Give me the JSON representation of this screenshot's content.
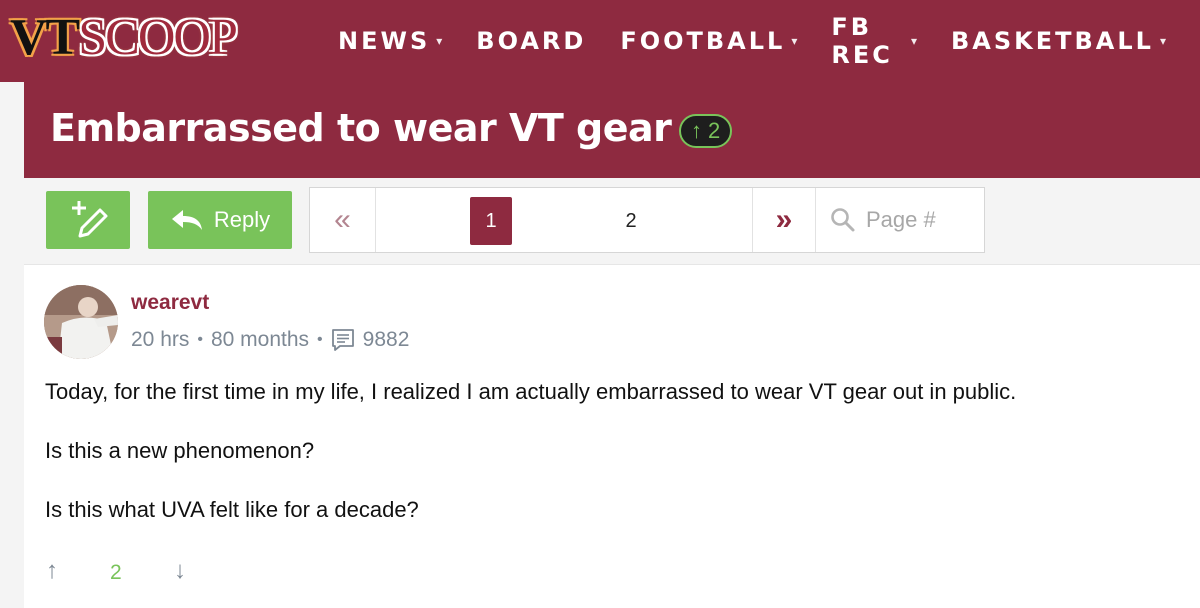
{
  "site": {
    "logo_a": "VT",
    "logo_b": "SCOOP"
  },
  "nav": [
    {
      "label": "NEWS",
      "caret": "▾"
    },
    {
      "label": "BOARD",
      "caret": ""
    },
    {
      "label": "FOOTBALL",
      "caret": "▾"
    },
    {
      "label": "FB REC",
      "caret": "▾"
    },
    {
      "label": "BASKETBALL",
      "caret": "▾"
    }
  ],
  "thread": {
    "title": "Embarrassed to wear VT gear",
    "vote_arrow": "↑",
    "vote_count": "2"
  },
  "toolbar": {
    "reply_label": "Reply",
    "page_placeholder": "Page #",
    "prev": "«",
    "next": "»",
    "pages": [
      "1",
      "2"
    ]
  },
  "post": {
    "username": "wearevt",
    "time": "20 hrs",
    "tenure": "80 months",
    "post_count": "9882",
    "paragraphs": [
      "Today, for the first time in my life, I realized I am actually embarrassed to wear VT gear out in public.",
      "Is this a new phenomenon?",
      "Is this what UVA felt like for a decade?"
    ],
    "vote_up": "↑",
    "votes": "2",
    "vote_down": "↓"
  },
  "colors": {
    "brand": "#8e2a40",
    "accent_green": "#79c35a"
  },
  "icons": [
    "new-thread-icon",
    "reply-arrow-icon",
    "search-icon",
    "comment-icon"
  ]
}
